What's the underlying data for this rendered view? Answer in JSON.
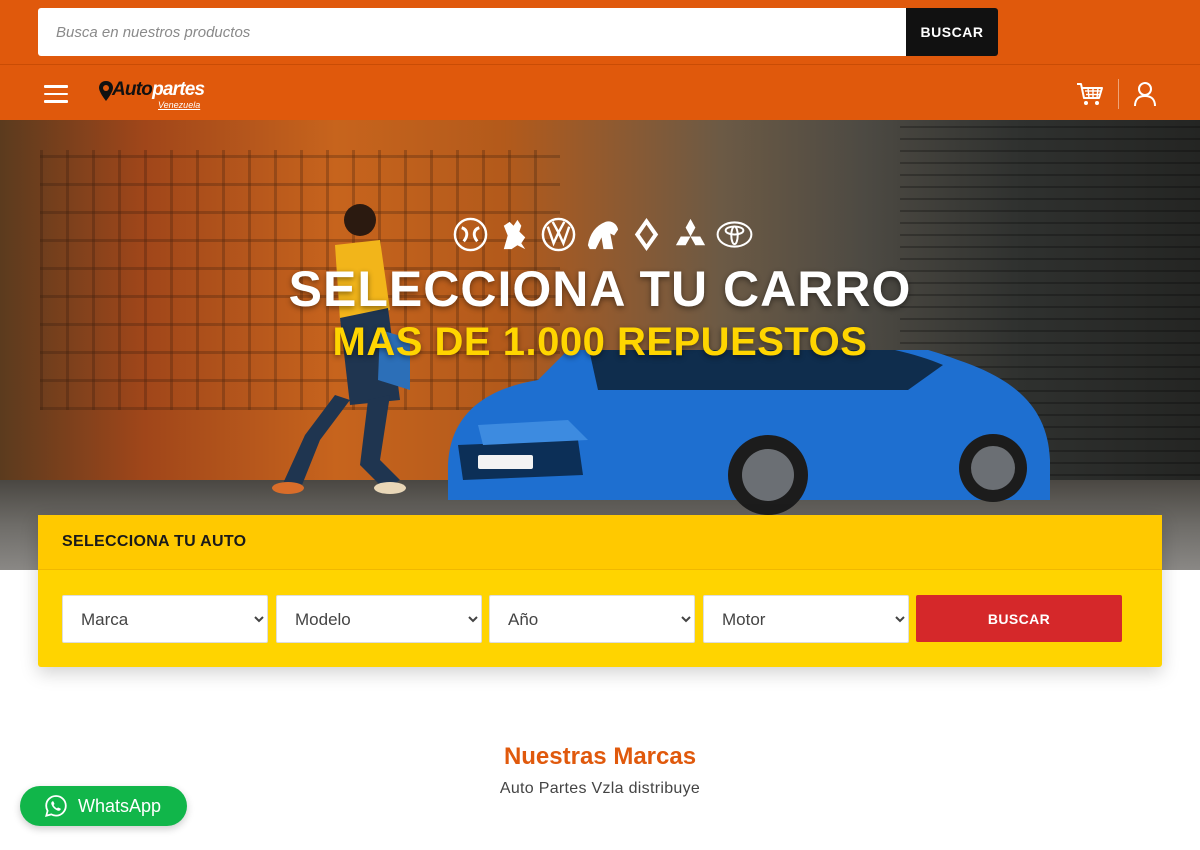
{
  "header": {
    "search_placeholder": "Busca en nuestros productos",
    "search_button": "BUSCAR"
  },
  "navbar": {
    "logo_brand_a": "Auto",
    "logo_brand_b": "partes",
    "logo_sub": "Venezuela",
    "icons": [
      "menu-icon",
      "cart-icon",
      "user-icon"
    ]
  },
  "hero": {
    "brand_logos": [
      "dongfeng",
      "peugeot",
      "volkswagen",
      "ferrari-horse",
      "renault",
      "mitsubishi",
      "toyota"
    ],
    "title": "SELECCIONA TU CARRO",
    "subtitle": "MAS DE 1.000 REPUESTOS"
  },
  "selector": {
    "heading": "SELECCIONA TU AUTO",
    "marca": "Marca",
    "modelo": "Modelo",
    "anio": "Año",
    "motor": "Motor",
    "button": "BUSCAR"
  },
  "brands_section": {
    "title": "Nuestras Marcas",
    "subtitle": "Auto Partes Vzla distribuye"
  },
  "whatsapp": {
    "label": "WhatsApp"
  },
  "colors": {
    "brand_orange": "#e0590c",
    "selector_yellow": "#ffd400",
    "buscar_red": "#d5282a",
    "whatsapp_green": "#11b64a",
    "subtitle_yellow": "#ffd500"
  }
}
